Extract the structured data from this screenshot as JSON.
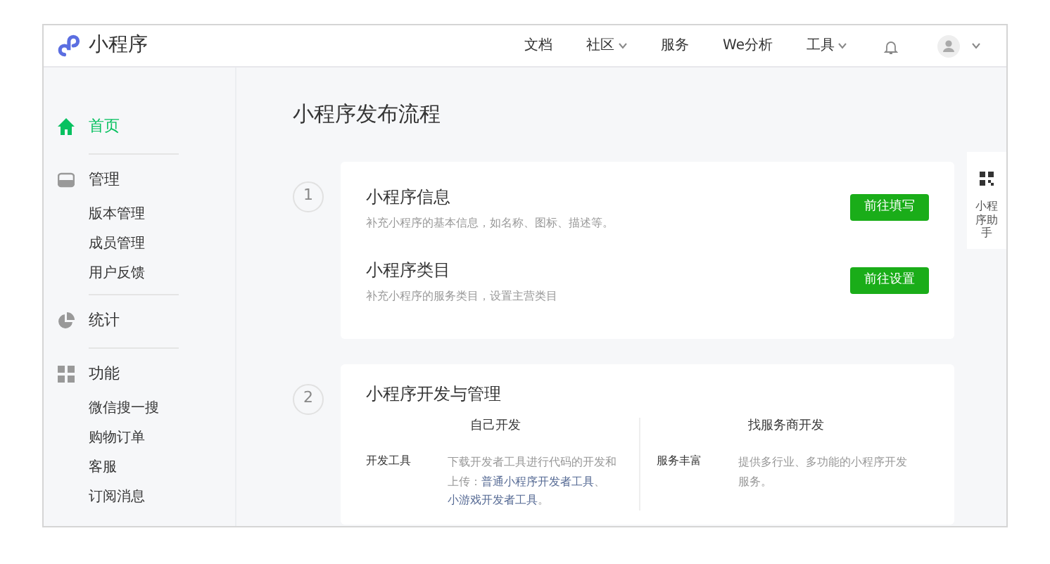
{
  "header": {
    "logo": "小程序",
    "nav": [
      {
        "label": "文档",
        "caret": false
      },
      {
        "label": "社区",
        "caret": true
      },
      {
        "label": "服务",
        "caret": false
      },
      {
        "label": "We分析",
        "caret": false
      },
      {
        "label": "工具",
        "caret": true
      }
    ]
  },
  "sidebar": [
    {
      "label": "首页",
      "selected": true
    },
    {
      "label": "管理",
      "selected": false,
      "children": [
        "版本管理",
        "成员管理",
        "用户反馈"
      ]
    },
    {
      "label": "统计",
      "selected": false
    },
    {
      "label": "功能",
      "selected": false,
      "children": [
        "微信搜一搜",
        "购物订单",
        "客服",
        "订阅消息"
      ]
    }
  ],
  "page_title": "小程序发布流程",
  "steps": [
    {
      "number": "1",
      "kind": "items",
      "items": [
        {
          "title": "小程序信息",
          "desc": "补充小程序的基本信息，如名称、图标、描述等。",
          "button": "前往填写"
        },
        {
          "title": "小程序类目",
          "desc": "补充小程序的服务类目，设置主营类目",
          "button": "前往设置"
        }
      ]
    },
    {
      "number": "2",
      "kind": "columns",
      "title": "小程序开发与管理",
      "columns": [
        {
          "heading": "自己开发",
          "rows": [
            {
              "label": "开发工具",
              "desc": [
                {
                  "kind": "text",
                  "text": "下载开发者工具进行代码的开发和上传："
                },
                {
                  "kind": "link",
                  "text": "普通小程序开发者工具"
                },
                {
                  "kind": "text",
                  "text": "、"
                },
                {
                  "kind": "link",
                  "text": "小游戏开发者工具"
                },
                {
                  "kind": "text",
                  "text": "。"
                }
              ]
            }
          ]
        },
        {
          "heading": "找服务商开发",
          "rows": [
            {
              "label": "服务丰富",
              "desc": [
                {
                  "kind": "text",
                  "text": "提供多行业、多功能的小程序开发服务。"
                }
              ]
            }
          ]
        }
      ]
    }
  ],
  "helper": {
    "label": "小程序助手"
  }
}
